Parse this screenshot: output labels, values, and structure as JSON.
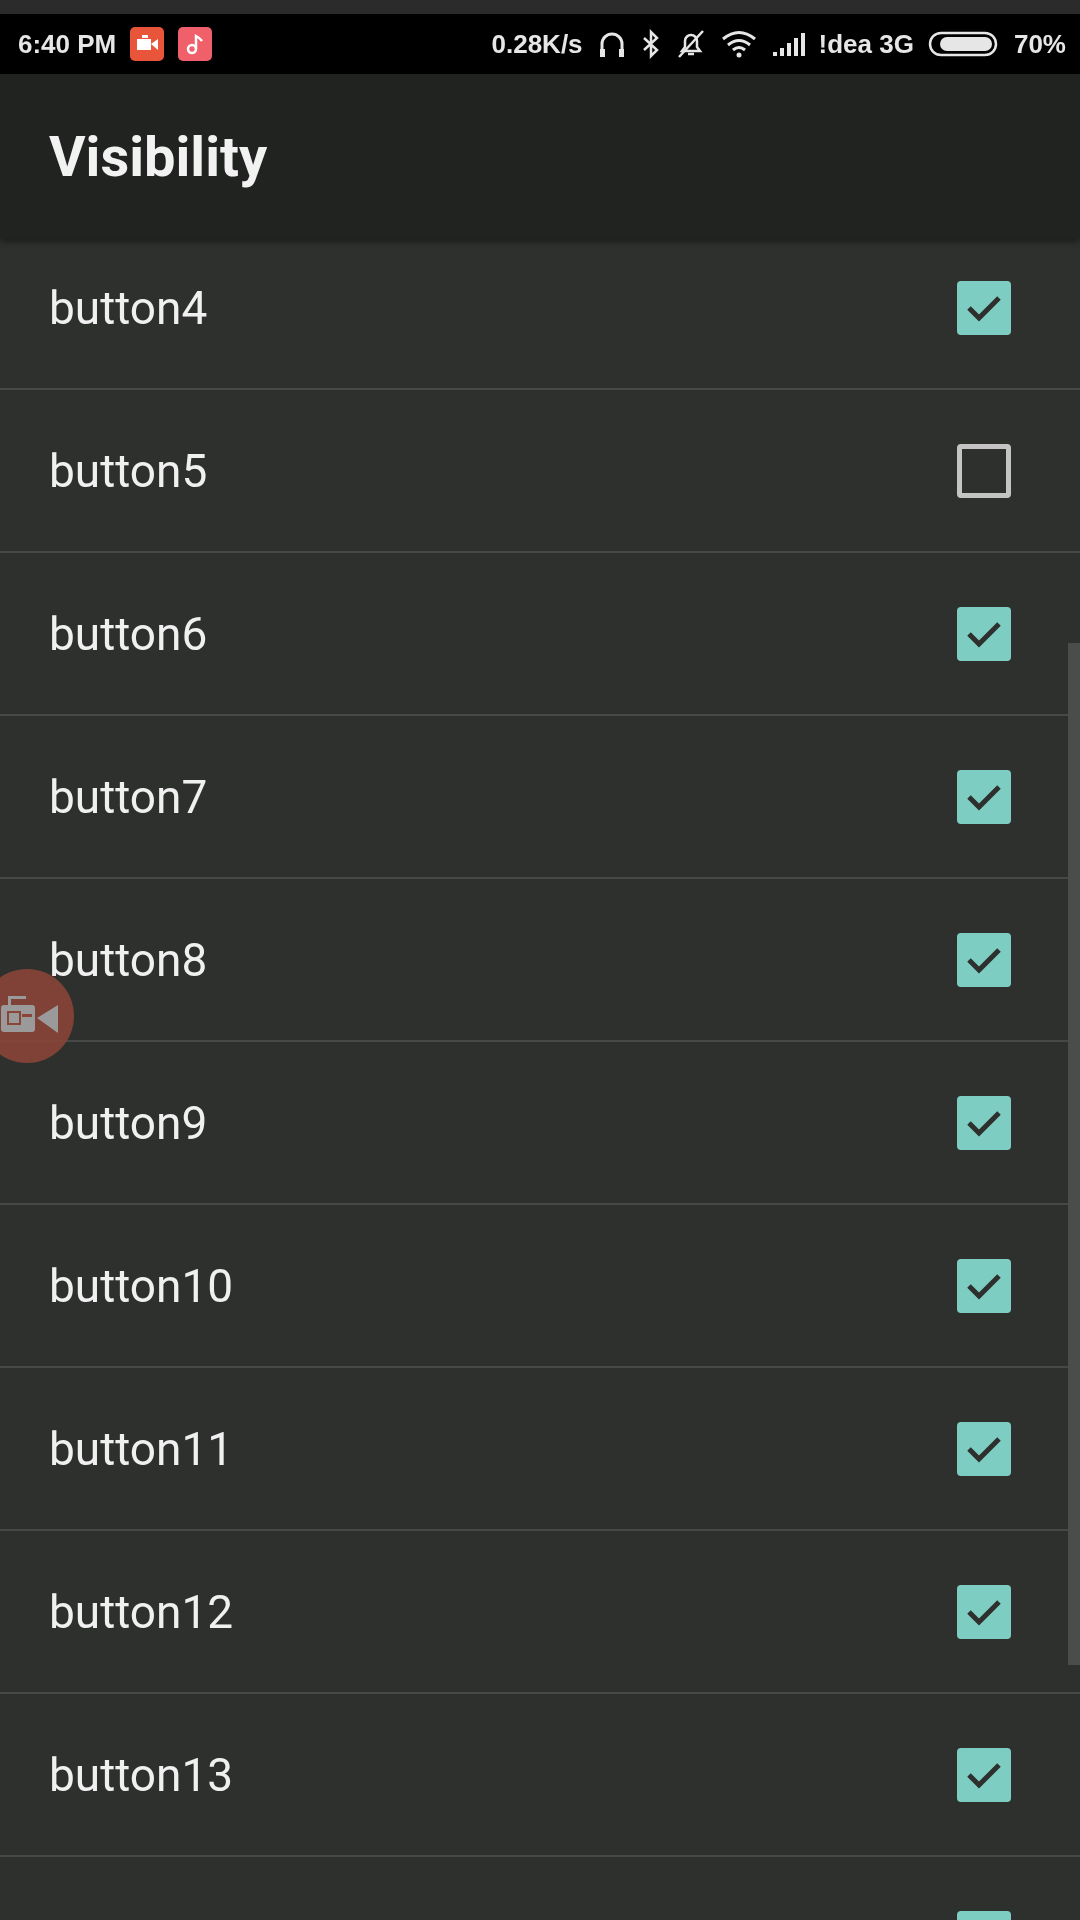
{
  "status_bar": {
    "time": "6:40 PM",
    "speed": "0.28K/s",
    "carrier": "!dea 3G",
    "battery": "70%"
  },
  "app_bar": {
    "title": "Visibility"
  },
  "items": [
    {
      "label": "button4",
      "checked": true
    },
    {
      "label": "button5",
      "checked": false
    },
    {
      "label": "button6",
      "checked": true
    },
    {
      "label": "button7",
      "checked": true
    },
    {
      "label": "button8",
      "checked": true
    },
    {
      "label": "button9",
      "checked": true
    },
    {
      "label": "button10",
      "checked": true
    },
    {
      "label": "button11",
      "checked": true
    },
    {
      "label": "button12",
      "checked": true
    },
    {
      "label": "button13",
      "checked": true
    },
    {
      "checked": true
    }
  ]
}
